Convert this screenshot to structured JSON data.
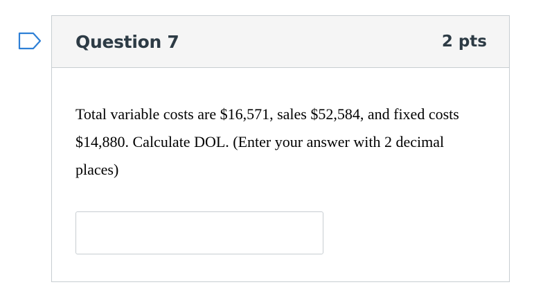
{
  "flag": {
    "icon": "bookmark-flag-icon",
    "color": "#2d7fd6"
  },
  "question": {
    "title": "Question 7",
    "points": "2 pts",
    "text": "Total variable costs are $16,571, sales $52,584, and fixed costs $14,880. Calculate DOL. (Enter your answer with 2 decimal places)",
    "answer_value": "",
    "answer_placeholder": ""
  },
  "colors": {
    "header_bg": "#f5f5f5",
    "border": "#c7cdd1",
    "title_text": "#2d3b45"
  }
}
